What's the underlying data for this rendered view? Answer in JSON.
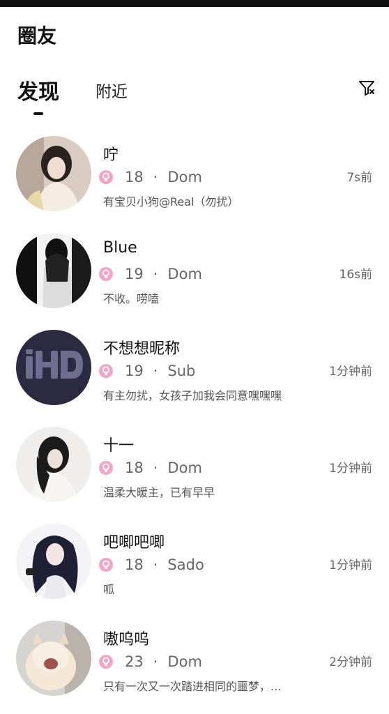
{
  "header": {
    "title": "圈友"
  },
  "tabs": [
    {
      "label": "发现",
      "active": true
    },
    {
      "label": "附近",
      "active": false
    }
  ],
  "filter_icon": "filter-icon",
  "colors": {
    "badge": "#f2a6c4",
    "accent_text": "#111111",
    "muted": "#666666"
  },
  "users": [
    {
      "name": "咛",
      "age": "18",
      "sep": "·",
      "role": "Dom",
      "time": "7s前",
      "bio": "有宝贝小狗@Real（勿扰）"
    },
    {
      "name": "Blue",
      "age": "19",
      "sep": "·",
      "role": "Dom",
      "time": "16s前",
      "bio": "不收。唠嗑"
    },
    {
      "name": "不想想昵称",
      "age": "19",
      "sep": "·",
      "role": "Sub",
      "time": "1分钟前",
      "bio": "有主勿扰，女孩子加我会同意嘿嘿嘿"
    },
    {
      "name": "十一",
      "age": "18",
      "sep": "·",
      "role": "Dom",
      "time": "1分钟前",
      "bio": "温柔大暖主，已有早早"
    },
    {
      "name": "吧唧吧唧",
      "age": "18",
      "sep": "·",
      "role": "Sado",
      "time": "1分钟前",
      "bio": "呱"
    },
    {
      "name": "嗷呜呜",
      "age": "23",
      "sep": "·",
      "role": "Dom",
      "time": "2分钟前",
      "bio": "只有一次又一次踏进相同的噩梦，..."
    }
  ]
}
